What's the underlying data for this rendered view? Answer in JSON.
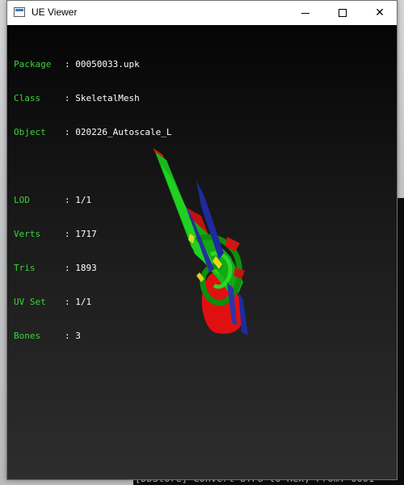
{
  "background_console": {
    "bottom_line": "[DDStore] Convert UTF8 to Hex, From: 0001"
  },
  "window": {
    "title": "UE Viewer",
    "icon": "app-window-icon",
    "buttons": {
      "minimize": "minimize-icon",
      "maximize": "maximize-icon",
      "close": "close-icon"
    }
  },
  "info": {
    "package": {
      "label": "Package",
      "value": "00050033.upk"
    },
    "class": {
      "label": "Class",
      "value": "SkeletalMesh"
    },
    "object": {
      "label": "Object",
      "value": "020226_Autoscale_L"
    },
    "lod": {
      "label": "LOD",
      "value": "1/1"
    },
    "verts": {
      "label": "Verts",
      "value": "1717"
    },
    "tris": {
      "label": "Tris",
      "value": "1893"
    },
    "uvset": {
      "label": "UV Set",
      "value": "1/1"
    },
    "bones": {
      "label": "Bones",
      "value": "3"
    }
  },
  "colors": {
    "label_green": "#3fd13f",
    "mesh_red": "#e01010",
    "mesh_green": "#19c419",
    "mesh_blue": "#1e2a9e",
    "mesh_yellow": "#d8d020"
  }
}
